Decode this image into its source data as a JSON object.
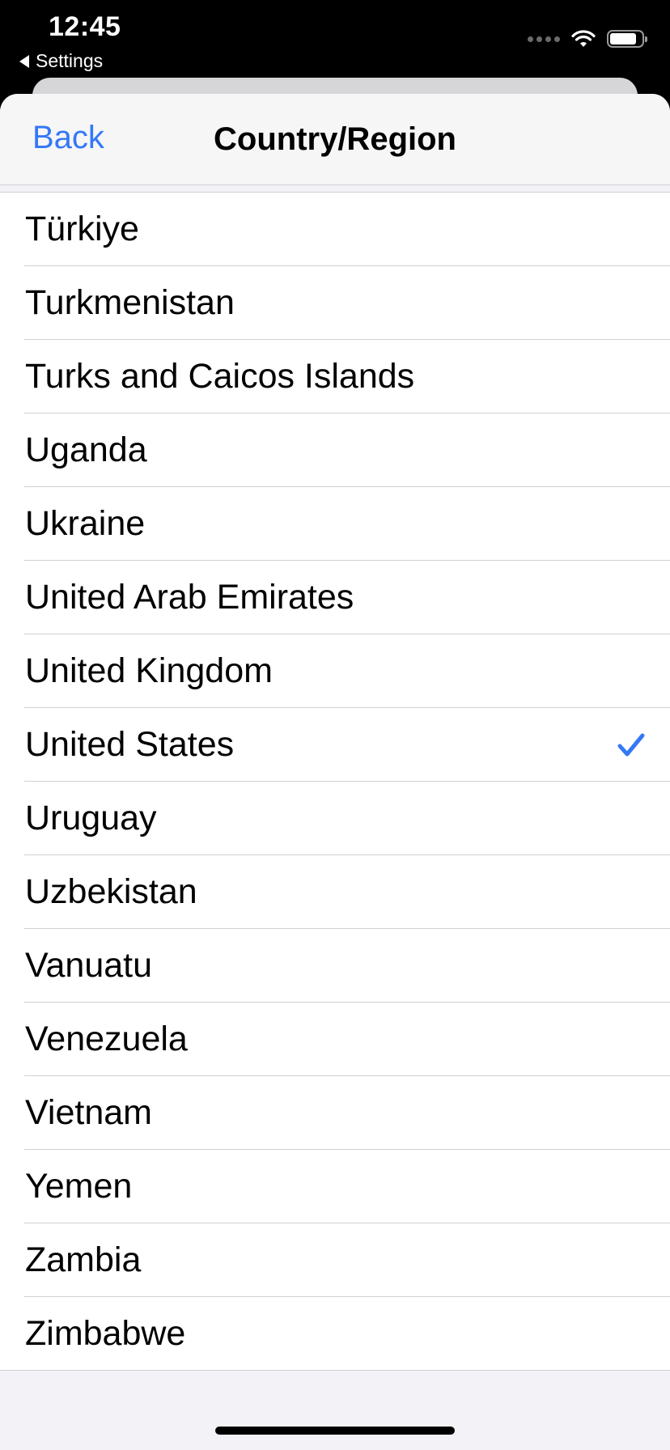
{
  "status_bar": {
    "time": "12:45",
    "back_app_label": "Settings",
    "battery_level": 0.85
  },
  "nav": {
    "back_label": "Back",
    "title": "Country/Region"
  },
  "list": {
    "items": [
      {
        "label": "Türkiye",
        "selected": false
      },
      {
        "label": "Turkmenistan",
        "selected": false
      },
      {
        "label": "Turks and Caicos Islands",
        "selected": false
      },
      {
        "label": "Uganda",
        "selected": false
      },
      {
        "label": "Ukraine",
        "selected": false
      },
      {
        "label": "United Arab Emirates",
        "selected": false
      },
      {
        "label": "United Kingdom",
        "selected": false
      },
      {
        "label": "United States",
        "selected": true
      },
      {
        "label": "Uruguay",
        "selected": false
      },
      {
        "label": "Uzbekistan",
        "selected": false
      },
      {
        "label": "Vanuatu",
        "selected": false
      },
      {
        "label": "Venezuela",
        "selected": false
      },
      {
        "label": "Vietnam",
        "selected": false
      },
      {
        "label": "Yemen",
        "selected": false
      },
      {
        "label": "Zambia",
        "selected": false
      },
      {
        "label": "Zimbabwe",
        "selected": false
      }
    ]
  },
  "colors": {
    "accent": "#3478f6",
    "background": "#f2f2f7"
  },
  "icons": {
    "checkmark": "checkmark-icon",
    "wifi": "wifi-icon",
    "battery": "battery-icon",
    "signal": "signal-icon"
  }
}
